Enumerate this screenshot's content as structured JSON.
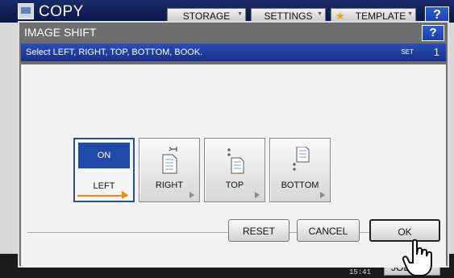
{
  "app": {
    "title": "COPY"
  },
  "top_tabs": [
    {
      "label": "STORAGE"
    },
    {
      "label": "SETTINGS"
    },
    {
      "label": "TEMPLATE"
    }
  ],
  "help_label": "?",
  "dialog": {
    "title": "IMAGE SHIFT",
    "help_label": "?",
    "message": "Select LEFT, RIGHT, TOP, BOTTOM, BOOK.",
    "set_label": "SET",
    "set_count": "1",
    "options": [
      {
        "label": "LEFT",
        "state": "ON",
        "selected": true
      },
      {
        "label": "RIGHT",
        "selected": false
      },
      {
        "label": "TOP",
        "selected": false
      },
      {
        "label": "BOTTOM",
        "selected": false
      }
    ],
    "buttons": {
      "reset": "RESET",
      "cancel": "CANCEL",
      "ok": "OK"
    }
  },
  "status": {
    "time": "15:41",
    "job_label": "JOB"
  },
  "colors": {
    "accent": "#1f4aa8",
    "selected_marker": "#f08a00",
    "message_bar": "#2a4fb8"
  }
}
